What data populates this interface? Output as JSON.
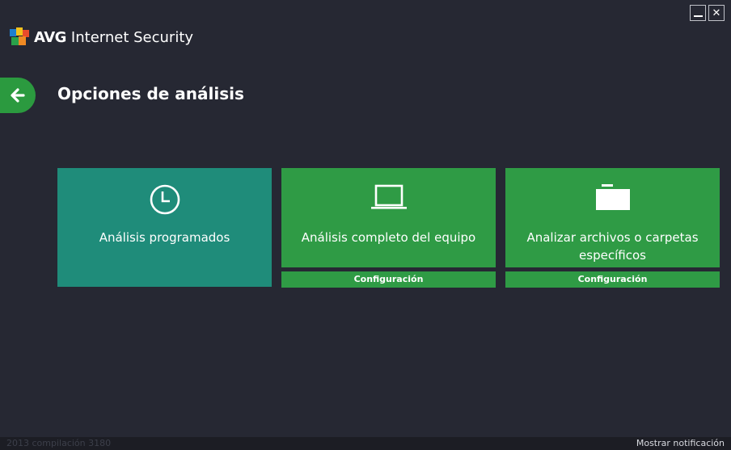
{
  "app": {
    "brand_bold": "AVG",
    "brand_name": "Internet Security"
  },
  "window_controls": {
    "minimize_icon": "minimize-icon",
    "close_icon": "close-icon"
  },
  "page": {
    "title": "Opciones de análisis",
    "back_icon": "arrow-left-icon"
  },
  "tiles": [
    {
      "label": "Análisis programados",
      "icon": "clock-icon",
      "color": "#1f8c7a"
    },
    {
      "label": "Análisis completo del equipo",
      "icon": "laptop-icon",
      "color": "#2f9b45",
      "config_label": "Configuración"
    },
    {
      "label": "Analizar archivos o carpetas específicos",
      "icon": "folder-icon",
      "color": "#2f9b45",
      "config_label": "Configuración"
    }
  ],
  "status_bar": {
    "build": "2013  compilación 3180",
    "notify_link": "Mostrar notificación"
  },
  "colors": {
    "background": "#262833",
    "accent_green": "#2f9b45",
    "teal": "#1f8c7a",
    "back_button": "#2b9a3f"
  }
}
